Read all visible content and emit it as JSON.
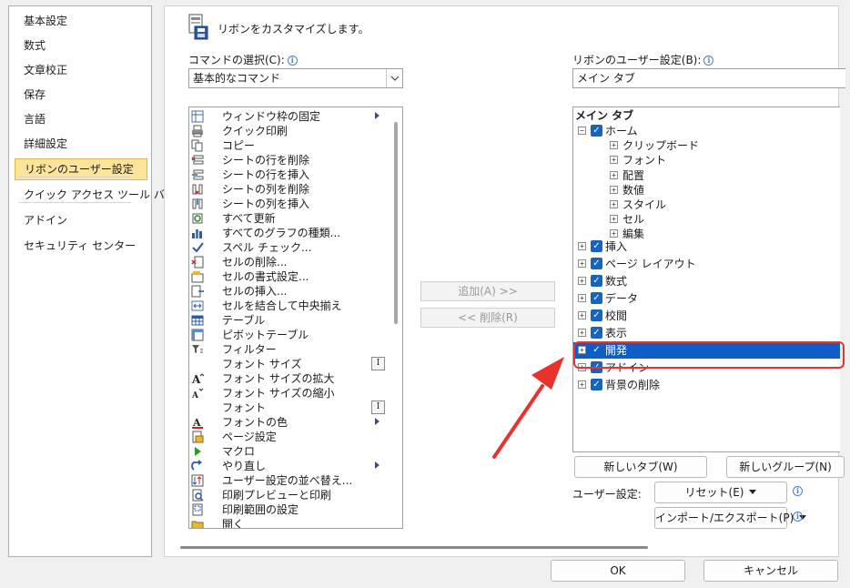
{
  "nav": {
    "items": [
      "基本設定",
      "数式",
      "文章校正",
      "保存",
      "言語",
      "詳細設定",
      "リボンのユーザー設定",
      "クイック アクセス ツール バー",
      "アドイン",
      "セキュリティ センター"
    ],
    "active_index": 6
  },
  "header": {
    "title": "リボンをカスタマイズします。"
  },
  "commands": {
    "label": "コマンドの選択(C):",
    "dropdown_value": "基本的なコマンド",
    "items": [
      {
        "label": "ウィンドウ枠の固定",
        "icon": "freeze-panes-icon",
        "submenu": true
      },
      {
        "label": "クイック印刷",
        "icon": "quick-print-icon"
      },
      {
        "label": "コピー",
        "icon": "copy-icon"
      },
      {
        "label": "シートの行を削除",
        "icon": "delete-row-icon"
      },
      {
        "label": "シートの行を挿入",
        "icon": "insert-row-icon"
      },
      {
        "label": "シートの列を削除",
        "icon": "delete-column-icon"
      },
      {
        "label": "シートの列を挿入",
        "icon": "insert-column-icon"
      },
      {
        "label": "すべて更新",
        "icon": "refresh-all-icon"
      },
      {
        "label": "すべてのグラフの種類...",
        "icon": "chart-types-icon"
      },
      {
        "label": "スペル チェック...",
        "icon": "spell-check-icon"
      },
      {
        "label": "セルの削除...",
        "icon": "delete-cells-icon"
      },
      {
        "label": "セルの書式設定...",
        "icon": "format-cells-icon"
      },
      {
        "label": "セルの挿入...",
        "icon": "insert-cells-icon"
      },
      {
        "label": "セルを結合して中央揃え",
        "icon": "merge-center-icon"
      },
      {
        "label": "テーブル",
        "icon": "table-icon"
      },
      {
        "label": "ピボットテーブル",
        "icon": "pivot-table-icon"
      },
      {
        "label": "フィルター",
        "icon": "filter-icon"
      },
      {
        "label": "フォント サイズ",
        "icon": "",
        "input": true
      },
      {
        "label": "フォント サイズの拡大",
        "icon": "increase-font-icon"
      },
      {
        "label": "フォント サイズの縮小",
        "icon": "decrease-font-icon"
      },
      {
        "label": "フォント",
        "icon": "",
        "input": true
      },
      {
        "label": "フォントの色",
        "icon": "font-color-icon",
        "submenu": true
      },
      {
        "label": "ページ設定",
        "icon": "page-setup-icon"
      },
      {
        "label": "マクロ",
        "icon": "macro-icon"
      },
      {
        "label": "やり直し",
        "icon": "redo-icon",
        "submenu": true
      },
      {
        "label": "ユーザー設定の並べ替え...",
        "icon": "custom-sort-icon"
      },
      {
        "label": "印刷プレビューと印刷",
        "icon": "print-preview-icon"
      },
      {
        "label": "印刷範囲の設定",
        "icon": "print-area-icon"
      },
      {
        "label": "開く",
        "icon": "open-icon"
      }
    ]
  },
  "middle": {
    "add_label": "追加(A) >>",
    "remove_label": "<< 削除(R)"
  },
  "ribbon": {
    "label": "リボンのユーザー設定(B):",
    "dropdown_value": "メイン タブ",
    "tree_header": "メイン タブ",
    "tree": [
      {
        "label": "ホーム",
        "level": 0,
        "expanded": true,
        "checked": true
      },
      {
        "label": "クリップボード",
        "level": 1
      },
      {
        "label": "フォント",
        "level": 1
      },
      {
        "label": "配置",
        "level": 1
      },
      {
        "label": "数値",
        "level": 1
      },
      {
        "label": "スタイル",
        "level": 1
      },
      {
        "label": "セル",
        "level": 1
      },
      {
        "label": "編集",
        "level": 1
      },
      {
        "label": "挿入",
        "level": 0,
        "checked": true
      },
      {
        "label": "ページ レイアウト",
        "level": 0,
        "checked": true
      },
      {
        "label": "数式",
        "level": 0,
        "checked": true
      },
      {
        "label": "データ",
        "level": 0,
        "checked": true
      },
      {
        "label": "校閲",
        "level": 0,
        "checked": true
      },
      {
        "label": "表示",
        "level": 0,
        "checked": true
      },
      {
        "label": "開発",
        "level": 0,
        "checked": true,
        "selected": true
      },
      {
        "label": "アドイン",
        "level": 0,
        "checked": true
      },
      {
        "label": "背景の削除",
        "level": 0,
        "checked": true
      }
    ],
    "new_tab_label": "新しいタブ(W)",
    "new_group_label": "新しいグループ(N)",
    "user_settings_label": "ユーザー設定:",
    "reset_label": "リセット(E)",
    "import_export_label": "インポート/エクスポート(P)"
  },
  "footer": {
    "ok_label": "OK",
    "cancel_label": "キャンセル"
  },
  "colors": {
    "accent": "#1664c0",
    "selection": "#0f5ec7",
    "highlight": "#fde49c",
    "annotation": "#e8322e"
  }
}
